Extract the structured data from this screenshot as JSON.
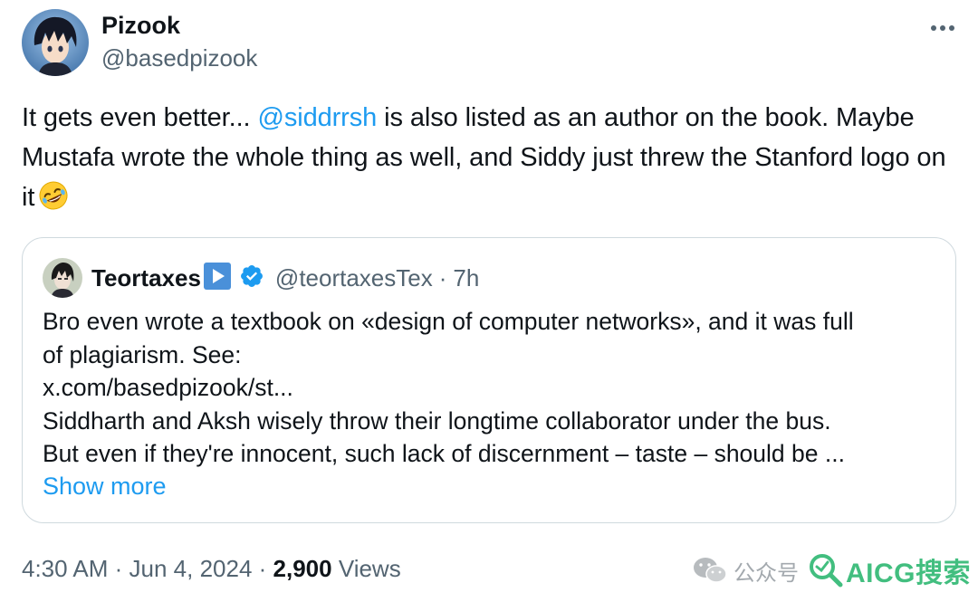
{
  "tweet": {
    "author": {
      "display_name": "Pizook",
      "handle": "@basedpizook",
      "avatar_icon": "anime-avatar-icon"
    },
    "more_icon": "more-horizontal-icon",
    "text": {
      "part1": "It gets even better... ",
      "mention": "@siddrrsh",
      "part2": " is also listed as an author on the book. Maybe Mustafa wrote the whole thing as well, and Siddy just threw the Stanford logo on it",
      "emoji": "rolling-on-floor-laughing-emoji"
    },
    "quote": {
      "display_name": "Teortaxes",
      "name_badge": "▶",
      "verified_icon": "verified-badge-icon",
      "handle": "@teortaxesTex",
      "dot": "·",
      "time": "7h",
      "lines": [
        "Bro even wrote a textbook on «design of computer networks», and it was full",
        "of plagiarism. See:",
        "x.com/basedpizook/st...",
        "Siddharth and Aksh wisely throw their longtime collaborator under the bus.",
        "But even if they're innocent, such lack of discernment – taste – should be ..."
      ],
      "show_more": "Show more"
    },
    "footer": {
      "time": "4:30 AM",
      "sep1": " · ",
      "date": "Jun 4, 2024",
      "sep2": " · ",
      "views_count": "2,900",
      "views_label": " Views"
    }
  },
  "watermark": {
    "wechat_label": "公众号",
    "brand": "AICG搜索"
  },
  "colors": {
    "accent": "#1d9bf0",
    "text": "#0f1419",
    "muted": "#536471",
    "border": "#cfd9de",
    "watermark_green": "#2eb872"
  }
}
